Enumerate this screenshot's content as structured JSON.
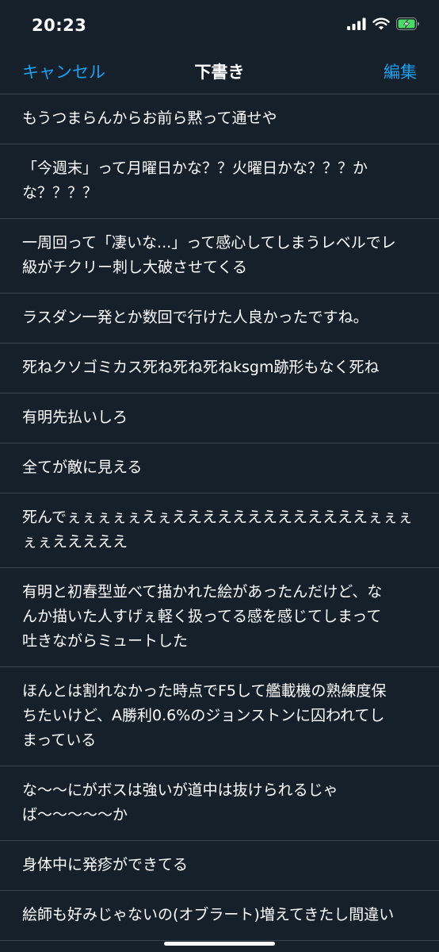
{
  "status_bar": {
    "time": "20:23"
  },
  "nav": {
    "cancel_label": "キャンセル",
    "title": "下書き",
    "edit_label": "編集"
  },
  "drafts": [
    "もうつまらんからお前ら黙って通せや",
    "「今週末」って月曜日かな？？火曜日かな？？？か\nな？？？？",
    "一周回って「凄いな...」って感心してしまうレベルでレ\n級がチクリー刺し大破させてくる",
    "ラスダン一発とか数回で行けた人良かったですね。",
    "死ねクソゴミカス死ね死ね死ねksgm跡形もなく死ね",
    "有明先払いしろ",
    "全てが敵に見える",
    "死んでぇぇぇぇぇえぇえええええええええええええぇぇぇ\nぇぇえええええ",
    "有明と初春型並べて描かれた絵があったんだけど、な\nんか描いた人すげぇ軽く扱ってる感を感じてしまって\n吐きながらミュートした",
    "ほんとは割れなかった時点でF5して艦載機の熟練度保\nちたいけど、A勝利0.6%のジョンストンに囚われてし\nまっている",
    "な〜〜にがボスは強いが道中は抜けられるじゃ\nば〜〜〜〜〜か",
    "身体中に発疹ができてる",
    "絵師も好みじゃないの(オブラート)増えてきたし間違い"
  ],
  "colors": {
    "background": "#15202b",
    "accent": "#1da1f2",
    "divider": "#38444d",
    "battery": "#4cd964"
  },
  "icons": {
    "signal": "cellular-signal-icon",
    "wifi": "wifi-icon",
    "battery": "battery-charging-icon"
  }
}
